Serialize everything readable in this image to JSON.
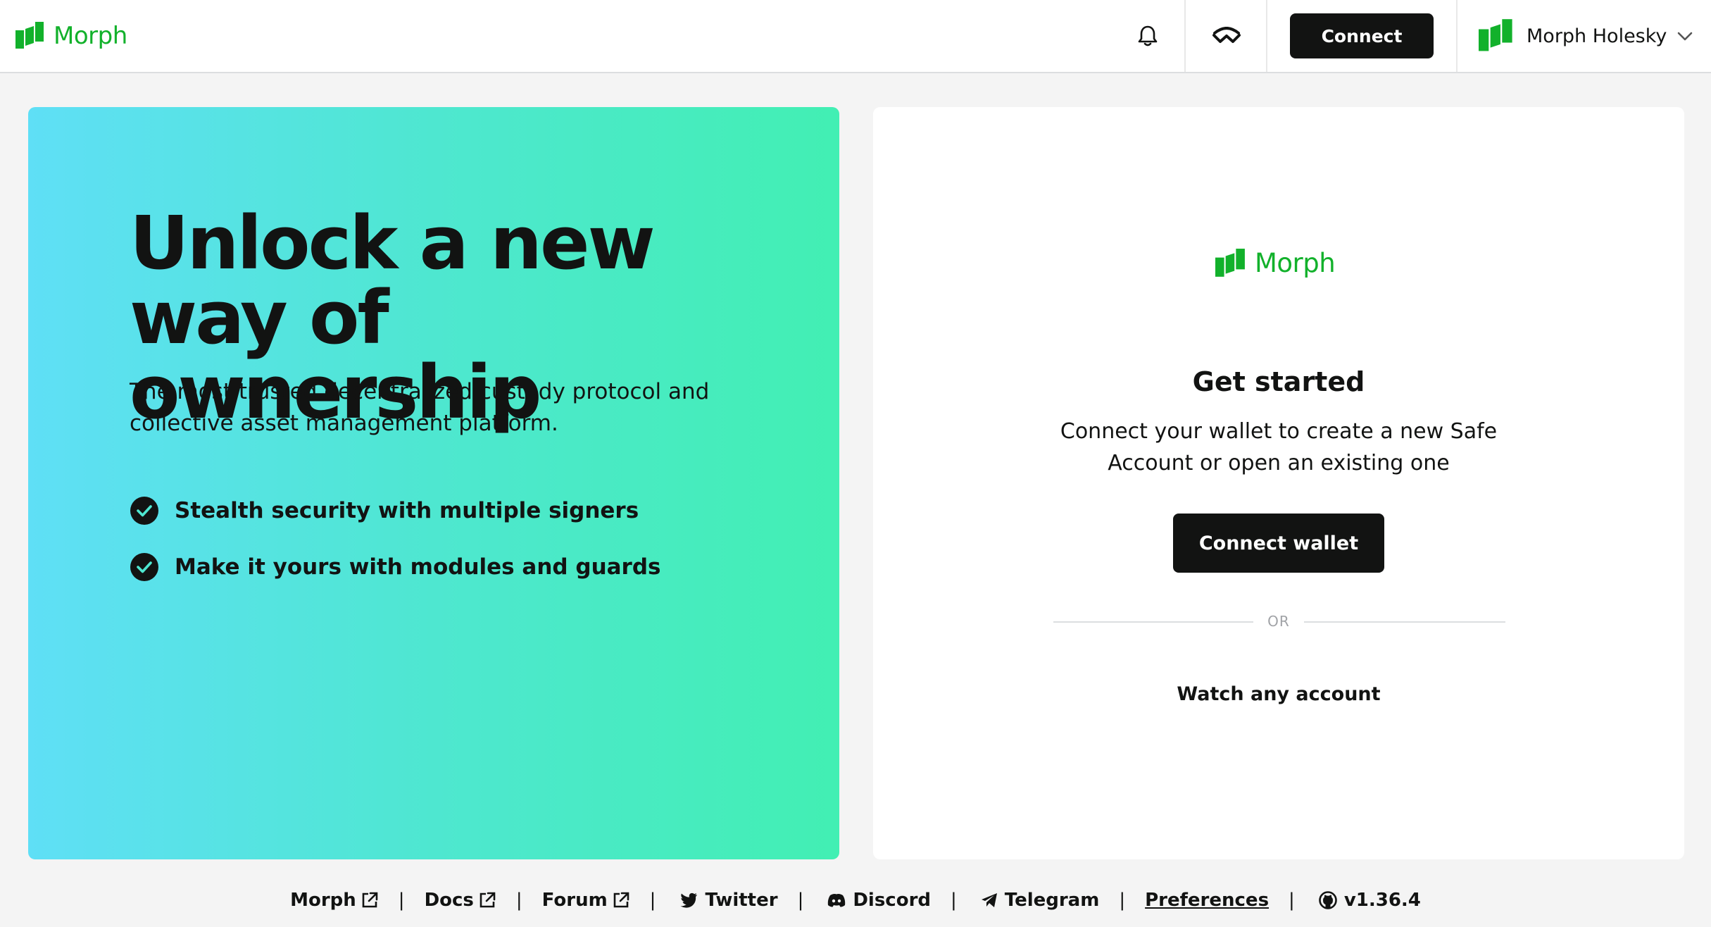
{
  "header": {
    "brand": "Morph",
    "connect_label": "Connect",
    "network_label": "Morph Holesky",
    "icons": [
      "bell-icon",
      "walletconnect-icon",
      "chevron-down-icon"
    ]
  },
  "hero": {
    "title": "Unlock a new way of ownership",
    "subtitle": "The most trusted decentralized custody protocol and collective asset management platform.",
    "features": [
      "Stealth security with multiple signers",
      "Make it yours with modules and guards"
    ]
  },
  "card": {
    "brand": "Morph",
    "title": "Get started",
    "description": "Connect your wallet to create a new Safe Account or open an existing one",
    "connect_wallet_label": "Connect wallet",
    "or_label": "OR",
    "watch_label": "Watch any account"
  },
  "footer": {
    "links": [
      "Morph",
      "Docs",
      "Forum",
      "Twitter",
      "Discord",
      "Telegram",
      "Preferences",
      "v1.36.4"
    ]
  },
  "colors": {
    "brand_green": "#12b12b",
    "button_dark": "#121312",
    "gradient_start": "#5fdff6",
    "gradient_end": "#42efb3"
  }
}
